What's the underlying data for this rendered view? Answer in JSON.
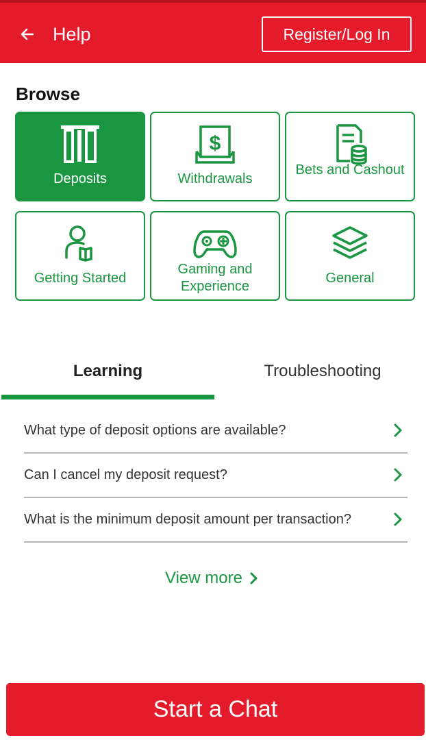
{
  "header": {
    "title": "Help",
    "back_icon": "arrow-left-icon",
    "register_label": "Register/Log In"
  },
  "browse": {
    "title": "Browse",
    "tiles": [
      {
        "label": "Deposits",
        "icon": "atm-card-slot-icon",
        "active": true
      },
      {
        "label": "Withdrawals",
        "icon": "dollar-bill-icon",
        "active": false
      },
      {
        "label": "Bets and Cashout",
        "icon": "receipt-coins-icon",
        "active": false
      },
      {
        "label": "Getting Started",
        "icon": "person-book-icon",
        "active": false
      },
      {
        "label": "Gaming and Experience",
        "icon": "gamepad-icon",
        "active": false
      },
      {
        "label": "General",
        "icon": "layers-icon",
        "active": false
      }
    ]
  },
  "tabs": [
    {
      "label": "Learning",
      "active": true
    },
    {
      "label": "Troubleshooting",
      "active": false
    }
  ],
  "faqs": [
    {
      "question": "What type of deposit options are available?"
    },
    {
      "question": "Can I cancel my deposit request?"
    },
    {
      "question": "What is the minimum deposit amount per transaction?"
    }
  ],
  "view_more_label": "View more",
  "chat_label": "Start a Chat",
  "colors": {
    "brand_red": "#e31b2b",
    "accent_green": "#1a9641"
  }
}
